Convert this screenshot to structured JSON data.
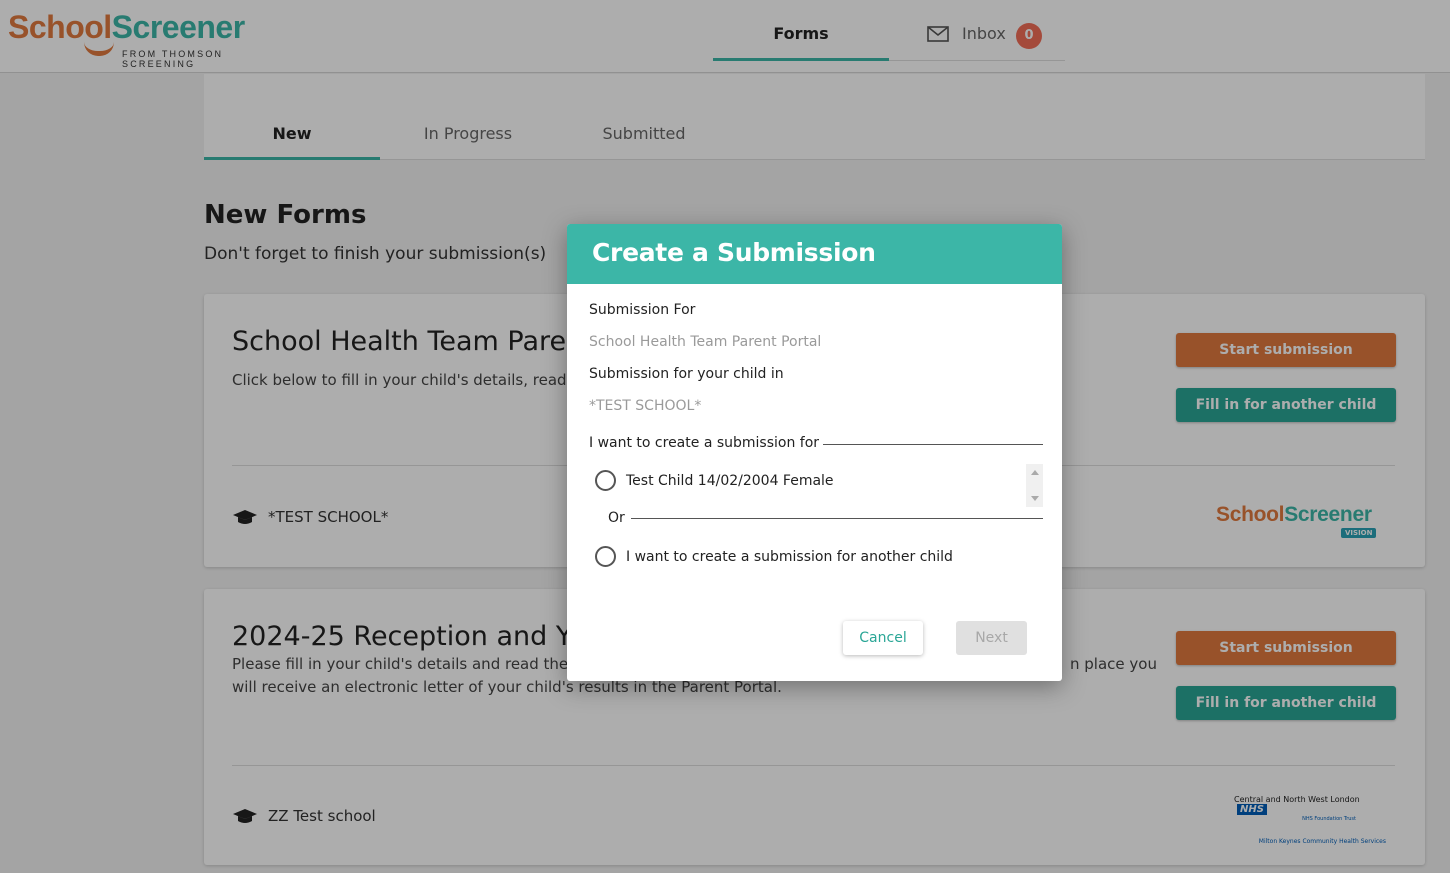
{
  "header": {
    "logo": {
      "part1": "School",
      "part2": "Screener",
      "tagline": "FROM THOMSON SCREENING"
    },
    "nav": {
      "forms": "Forms",
      "inbox": "Inbox",
      "inbox_count": "0"
    }
  },
  "tabs": [
    {
      "label": "New"
    },
    {
      "label": "In Progress"
    },
    {
      "label": "Submitted"
    }
  ],
  "page": {
    "title": "New Forms",
    "subtitle": "Don't forget to finish your submission(s)"
  },
  "forms": [
    {
      "title": "School Health Team Parent",
      "description": "Click below to fill in your child's details, read th",
      "school": "*TEST SCHOOL*",
      "start_label": "Start submission",
      "another_label": "Fill in for another child",
      "partner": {
        "part1": "School",
        "part2": "Screener",
        "tag": "VISION"
      }
    },
    {
      "title": "2024-25 Reception and Yea",
      "description": "Please fill in your child's details and read the in",
      "description_tail": "n place you",
      "description_line2": "will receive an electronic letter of your child's results in the Parent Portal.",
      "school": "ZZ Test school",
      "start_label": "Start submission",
      "another_label": "Fill in for another child",
      "partner": {
        "line1": "Central and North West London",
        "nhs": "NHS",
        "line2": "NHS Foundation Trust",
        "line3": "Milton Keynes Community Health Services"
      }
    }
  ],
  "modal": {
    "title": "Create a Submission",
    "submission_for_label": "Submission For",
    "submission_for_value": "School Health Team Parent Portal",
    "child_in_label": "Submission for your child in",
    "child_in_value": "*TEST SCHOOL*",
    "legend": "I want to create a submission for",
    "child_option": "Test Child 14/02/2004 Female",
    "or_label": "Or",
    "another_option": "I want to create a submission for another child",
    "cancel_label": "Cancel",
    "next_label": "Next"
  }
}
